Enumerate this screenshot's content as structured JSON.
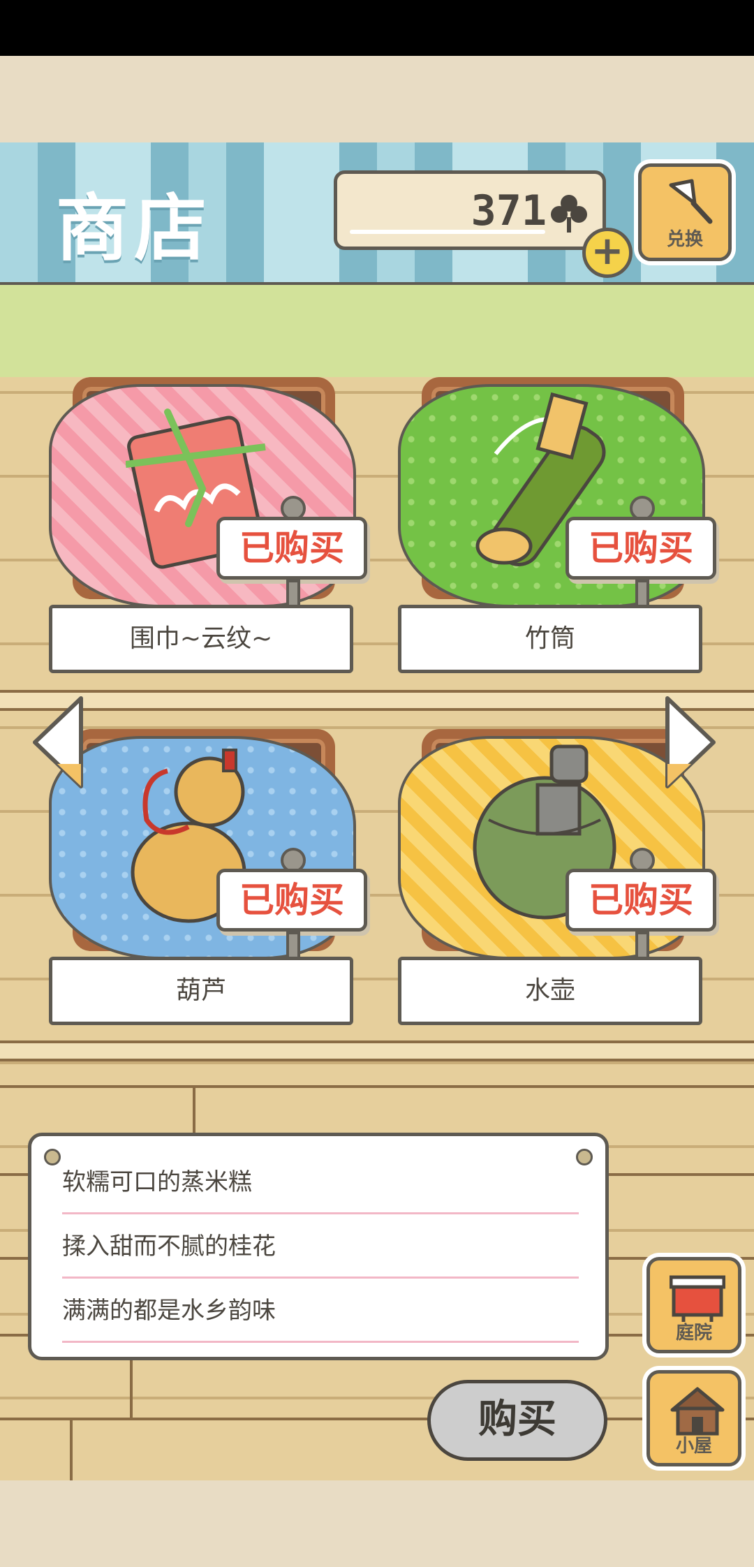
{
  "header": {
    "title": "商店",
    "clover_count": "371",
    "plus_label": "+",
    "exchange_label": "兑换"
  },
  "items": [
    {
      "name": "围巾~云纹~",
      "status": "已购买",
      "cloth_color": "#f59aa8"
    },
    {
      "name": "竹筒",
      "status": "已购买",
      "cloth_color": "#74c246"
    },
    {
      "name": "葫芦",
      "status": "已购买",
      "cloth_color": "#7fb5e2"
    },
    {
      "name": "水壶",
      "status": "已购买",
      "cloth_color": "#f6c243"
    }
  ],
  "description": {
    "lines": [
      "软糯可口的蒸米糕",
      "揉入甜而不腻的桂花",
      "满满的都是水乡韵味"
    ]
  },
  "actions": {
    "buy_label": "购买",
    "yard_label": "庭院",
    "house_label": "小屋"
  },
  "icons": {
    "clover": "clover-icon",
    "exchange": "bell-icon",
    "yard": "yard-icon",
    "house": "house-icon",
    "prev": "left-arrow-icon",
    "next": "right-arrow-icon"
  },
  "colors": {
    "accent_yellow": "#f4c265",
    "purchased_red": "#e6513e",
    "header_blue": "#7fb8c8"
  }
}
